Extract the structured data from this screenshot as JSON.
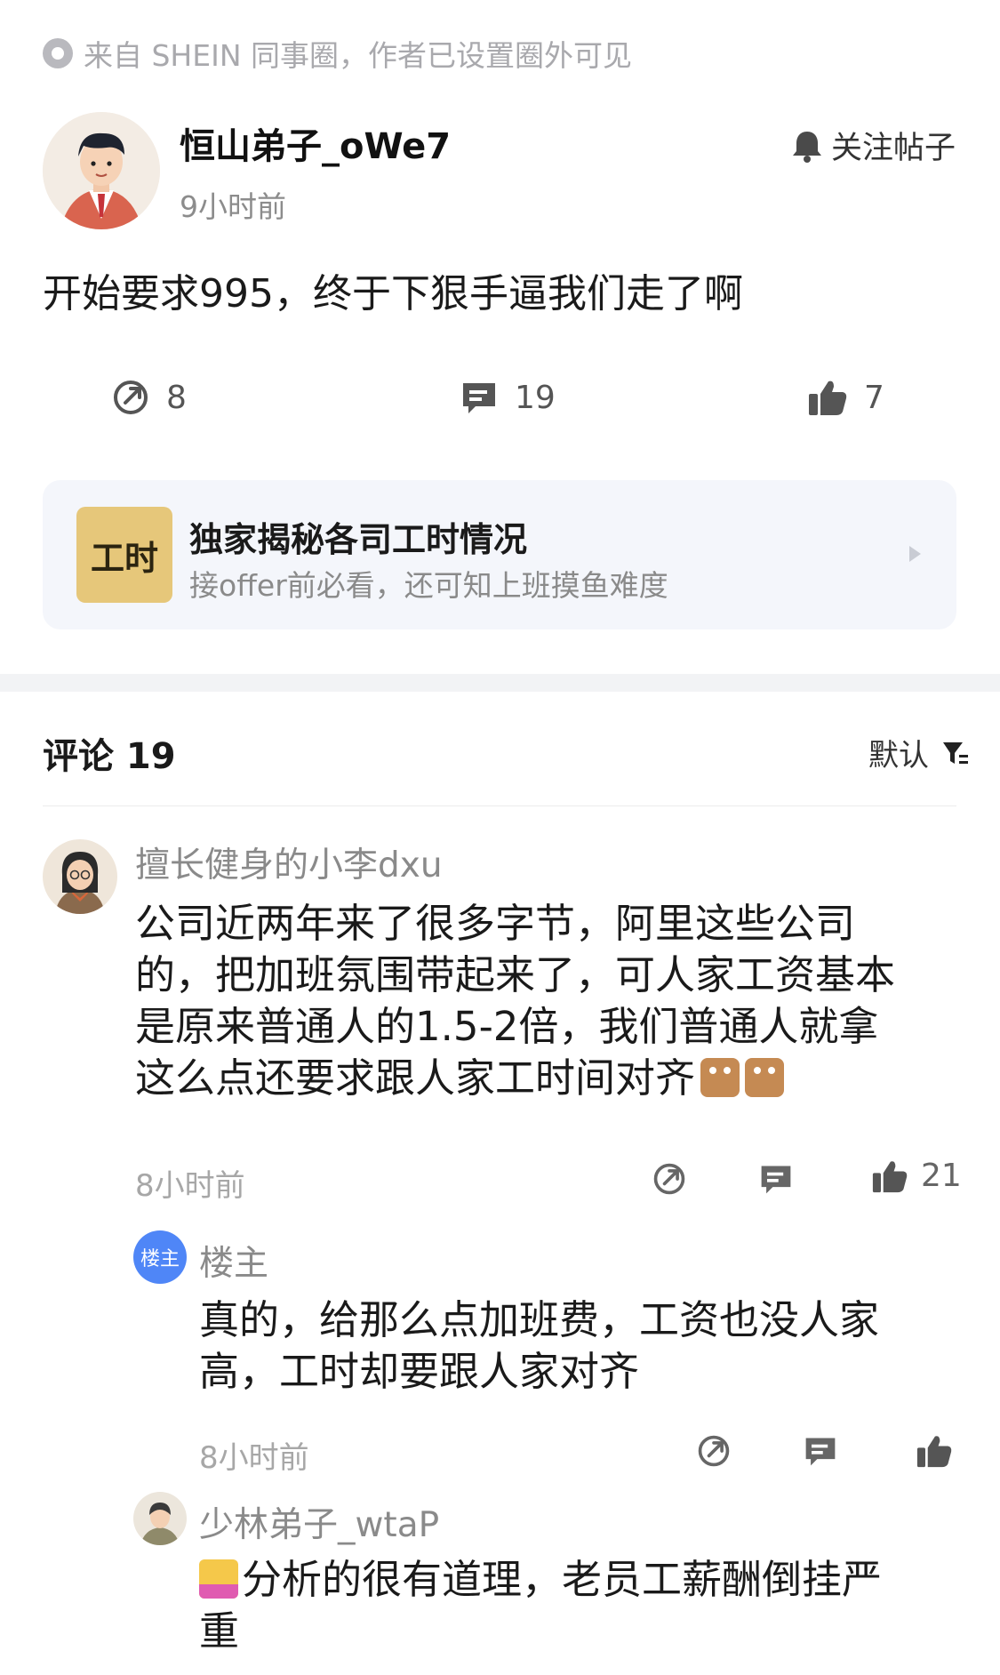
{
  "source_note": "来自 SHEIN 同事圈，作者已设置圈外可见",
  "post": {
    "author": "恒山弟子_oWe7",
    "time": "9小时前",
    "follow_label": "关注帖子",
    "text": "开始要求995，终于下狠手逼我们走了啊",
    "stats": {
      "shares": "8",
      "comments": "19",
      "likes": "7"
    }
  },
  "banner": {
    "logo_text": "工时",
    "title": "独家揭秘各司工时情况",
    "subtitle": "接offer前必看，还可知上班摸鱼难度"
  },
  "comments_header": {
    "label": "评论 19",
    "sort_label": "默认"
  },
  "comments": [
    {
      "user": "擅长健身的小李dxu",
      "lines": [
        "公司近两年来了很多字节，阿里这些公司",
        "的，把加班氛围带起来了，可人家工资基本",
        "是原来普通人的1.5-2倍，我们普通人就拿",
        "这么点还要求跟人家工时间对齐"
      ],
      "time": "8小时前",
      "likes": "21"
    }
  ],
  "replies": [
    {
      "badge": "楼主",
      "user": "楼主",
      "lines": [
        "真的，给那么点加班费，工资也没人家",
        "高，工时却要跟人家对齐"
      ],
      "time": "8小时前"
    },
    {
      "user": "少林弟子_wtaP",
      "lines": [
        "分析的很有道理，老员工薪酬倒挂严",
        "重"
      ]
    }
  ],
  "colors": {
    "accent_blue": "#4f86f7",
    "muted": "#8a8a8a",
    "banner_bg": "#f4f6fb"
  }
}
